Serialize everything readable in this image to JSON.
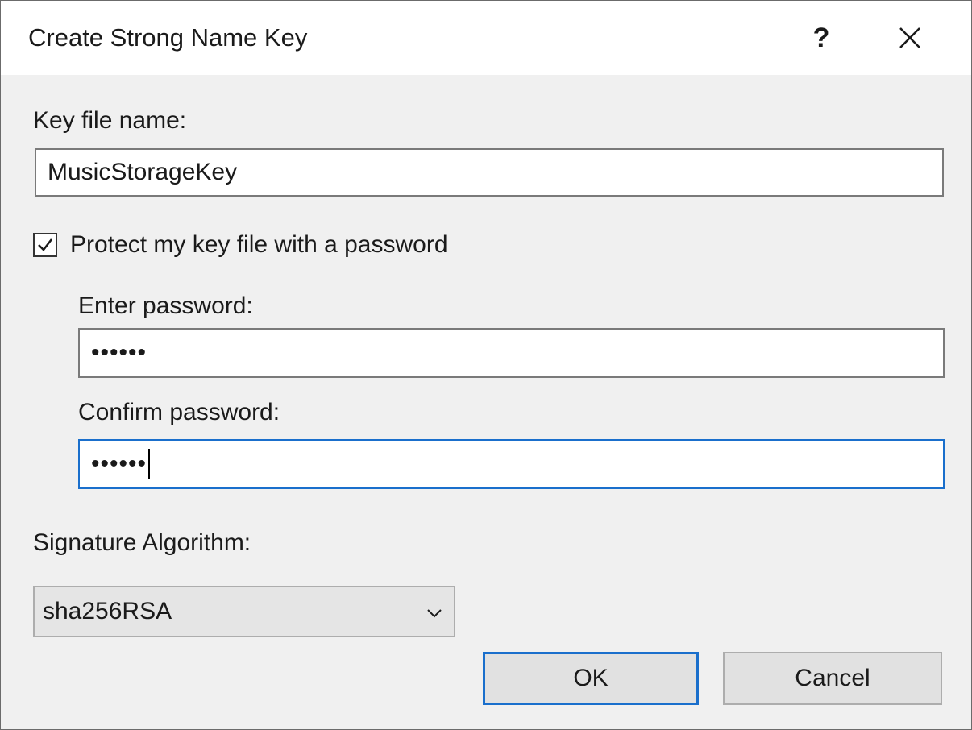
{
  "dialog": {
    "title": "Create Strong Name Key",
    "help_label": "?",
    "close_icon": "close-icon"
  },
  "key_file": {
    "label": "Key file name:",
    "value": "MusicStorageKey"
  },
  "protect": {
    "label": "Protect my key file with a password",
    "checked": true
  },
  "enter_password": {
    "label": "Enter password:",
    "value": "••••••"
  },
  "confirm_password": {
    "label": "Confirm password:",
    "value": "••••••"
  },
  "signature": {
    "label": "Signature Algorithm:",
    "selected": "sha256RSA"
  },
  "buttons": {
    "ok": "OK",
    "cancel": "Cancel"
  },
  "colors": {
    "focus_accent": "#1a6fcc",
    "content_bg": "#f0f0f0"
  }
}
